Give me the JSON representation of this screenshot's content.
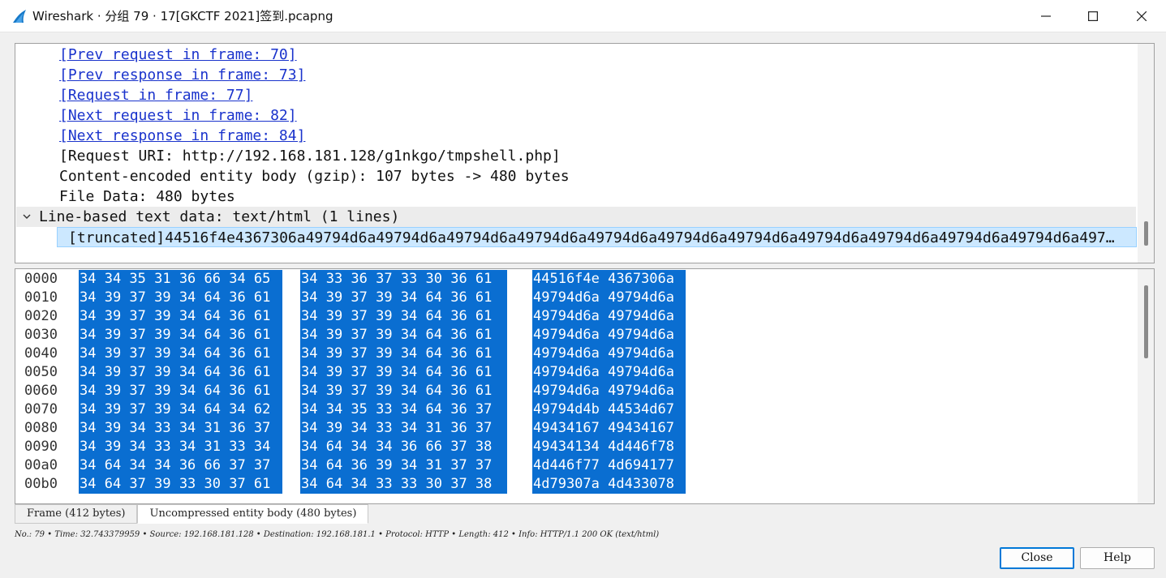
{
  "window": {
    "title": "Wireshark · 分组 79 · 17[GKCTF 2021]签到.pcapng",
    "app_icon": "wireshark-fin-icon",
    "accent_color": "#0a6ed1"
  },
  "detail_tree": {
    "lines": [
      {
        "text": "[Prev request in frame: 70]",
        "type": "link"
      },
      {
        "text": "[Prev response in frame: 73]",
        "type": "link"
      },
      {
        "text": "[Request in frame: 77]",
        "type": "link"
      },
      {
        "text": "[Next request in frame: 82]",
        "type": "link"
      },
      {
        "text": "[Next response in frame: 84]",
        "type": "link"
      },
      {
        "text": "[Request URI: http://192.168.181.128/g1nkgo/tmpshell.php]",
        "type": "text"
      },
      {
        "text": "Content-encoded entity body (gzip): 107 bytes -> 480 bytes",
        "type": "text"
      },
      {
        "text": "File Data: 480 bytes",
        "type": "text"
      }
    ],
    "expanded_node": "Line-based text data: text/html (1 lines)",
    "selected_line": "[truncated]44516f4e4367306a49794d6a49794d6a49794d6a49794d6a49794d6a49794d6a49794d6a49794d6a49794d6a49794d6a49794d6a497…"
  },
  "bytes": {
    "rows": [
      {
        "offset": "0000",
        "hex_a": "34 34 35 31 36 66 34 65",
        "hex_b": "34 33 36 37 33 30 36 61",
        "ascii": "44516f4e 4367306a"
      },
      {
        "offset": "0010",
        "hex_a": "34 39 37 39 34 64 36 61",
        "hex_b": "34 39 37 39 34 64 36 61",
        "ascii": "49794d6a 49794d6a"
      },
      {
        "offset": "0020",
        "hex_a": "34 39 37 39 34 64 36 61",
        "hex_b": "34 39 37 39 34 64 36 61",
        "ascii": "49794d6a 49794d6a"
      },
      {
        "offset": "0030",
        "hex_a": "34 39 37 39 34 64 36 61",
        "hex_b": "34 39 37 39 34 64 36 61",
        "ascii": "49794d6a 49794d6a"
      },
      {
        "offset": "0040",
        "hex_a": "34 39 37 39 34 64 36 61",
        "hex_b": "34 39 37 39 34 64 36 61",
        "ascii": "49794d6a 49794d6a"
      },
      {
        "offset": "0050",
        "hex_a": "34 39 37 39 34 64 36 61",
        "hex_b": "34 39 37 39 34 64 36 61",
        "ascii": "49794d6a 49794d6a"
      },
      {
        "offset": "0060",
        "hex_a": "34 39 37 39 34 64 36 61",
        "hex_b": "34 39 37 39 34 64 36 61",
        "ascii": "49794d6a 49794d6a"
      },
      {
        "offset": "0070",
        "hex_a": "34 39 37 39 34 64 34 62",
        "hex_b": "34 34 35 33 34 64 36 37",
        "ascii": "49794d4b 44534d67"
      },
      {
        "offset": "0080",
        "hex_a": "34 39 34 33 34 31 36 37",
        "hex_b": "34 39 34 33 34 31 36 37",
        "ascii": "49434167 49434167"
      },
      {
        "offset": "0090",
        "hex_a": "34 39 34 33 34 31 33 34",
        "hex_b": "34 64 34 34 36 66 37 38",
        "ascii": "49434134 4d446f78"
      },
      {
        "offset": "00a0",
        "hex_a": "34 64 34 34 36 66 37 37",
        "hex_b": "34 64 36 39 34 31 37 37",
        "ascii": "4d446f77 4d694177"
      },
      {
        "offset": "00b0",
        "hex_a": "34 64 37 39 33 30 37 61",
        "hex_b": "34 64 34 33 33 30 37 38",
        "ascii": "4d79307a 4d433078"
      }
    ]
  },
  "tabs": [
    {
      "label": "Frame (412 bytes)",
      "active": false
    },
    {
      "label": "Uncompressed entity body (480 bytes)",
      "active": true
    }
  ],
  "status_line": "No.: 79 • Time: 32.743379959 • Source: 192.168.181.128 • Destination: 192.168.181.1 • Protocol: HTTP • Length: 412 • Info: HTTP/1.1 200 OK (text/html)",
  "buttons": {
    "close_label": "Close",
    "help_label": "Help"
  }
}
